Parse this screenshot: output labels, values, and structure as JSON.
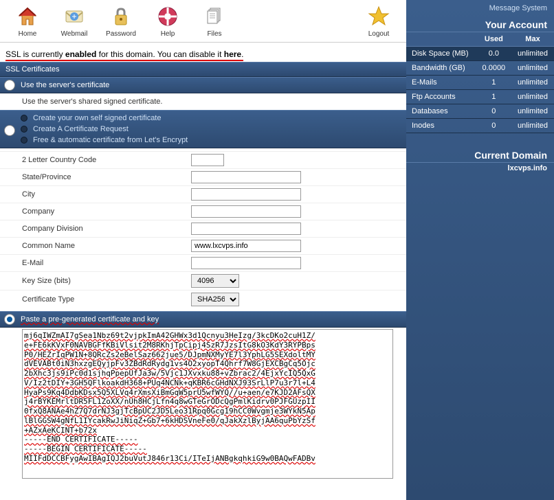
{
  "toolbar": {
    "home": "Home",
    "webmail": "Webmail",
    "password": "Password",
    "help": "Help",
    "files": "Files",
    "logout": "Logout"
  },
  "ssl_status": {
    "prefix": "SSL is currently ",
    "state": "enabled",
    "mid": " for this domain. You can disable it ",
    "link": "here",
    "dot": "."
  },
  "panels": {
    "certs_header": "SSL Certificates",
    "use_server": "Use the server's certificate",
    "use_server_desc": "Use the server's shared signed certificate.",
    "create_self": "Create your own self signed certificate",
    "create_csr": "Create A Certificate Request",
    "lets_encrypt": "Free & automatic certificate from Let's Encrypt",
    "paste": "Paste a pre-generated certificate and key"
  },
  "form": {
    "country": "2 Letter Country Code",
    "state": "State/Province",
    "city": "City",
    "company": "Company",
    "division": "Company Division",
    "common": "Common Name",
    "common_value": "www.lxcvps.info",
    "email": "E-Mail",
    "keysize": "Key Size (bits)",
    "keysize_value": "4096",
    "certtype": "Certificate Type",
    "certtype_value": "SHA256"
  },
  "cert_text": "mj6qIWZmAI7gSea1Nbz69t2vjpkImA42GHWx3d1Qcnyu3HeIzg/3kcDKo2cuH1Z/\ne+FE6kKVxF0NAVBGFfKBiVlsit2M8RKhjTpCipj4SzR7JzsItG8kO3KdY3RYPBps\nP0/HEZrIqPW1N+8QRcZs2eBelSaz662jue5/DJpmNXMyYE7l3YphLG5SEXdoltMY\ndVEVABt0iN3hxzgEQyjpFv3ZBdRdRydg1vs4O2xyopT4Qhrf7W8GjEXCBgCq5Ojc\n2bXhc3js9iPc0d1sjhqPpepUfJa3w/5Vjc1JXvxku88+vZbrac2/4EjxYcIQ5QxG\nV/Iz2tDIY+3GH5QFlkoakdH368+PUq4NCNk+qKBR6cGHdNXJ93SrLlP7u3r7l+L4\nHyaPs9Kq4DdbKDsx5Q5XLVq4rXmsXiBmGqW5prU5wfWYQ//u+aen/e7KJD2AFsQX\nj4rBYKEMrltDR5FL1ZoXX/nUh8HCjLfn4q8wGTeGrODcQgPmlKidrv0PJFGUzpII\n0fxQ8ANAe4hZ7Q7drNJ3gjTcBpUC2JD5Leo31Rpq0Gcg19hCC0Wvgmje3WYkN5Ap\nlBlGGSW4gNfL1IYcakRwJiNiqZ+Gb7+6kHDSVneFe0/qJakXzlByjAA6quPbYzSf\n+AZxAeKCINT+b72x\n-----END CERTIFICATE-----\n-----BEGIN CERTIFICATE-----\nMIIFdDCCBFygAwIBAgIQJ2buVutJ846r13Ci/ITeIjANBgkqhkiG9w0BAQwFADBv",
  "sidebar": {
    "msg": "Message System",
    "account": "Your Account",
    "used": "Used",
    "max": "Max",
    "rows": [
      {
        "label": "Disk Space (MB)",
        "used": "0.0",
        "max": "unlimited"
      },
      {
        "label": "Bandwidth (GB)",
        "used": "0.0000",
        "max": "unlimited"
      },
      {
        "label": "E-Mails",
        "used": "1",
        "max": "unlimited"
      },
      {
        "label": "Ftp Accounts",
        "used": "1",
        "max": "unlimited"
      },
      {
        "label": "Databases",
        "used": "0",
        "max": "unlimited"
      },
      {
        "label": "Inodes",
        "used": "0",
        "max": "unlimited"
      }
    ],
    "current_domain_title": "Current Domain",
    "current_domain": "lxcvps.info"
  }
}
